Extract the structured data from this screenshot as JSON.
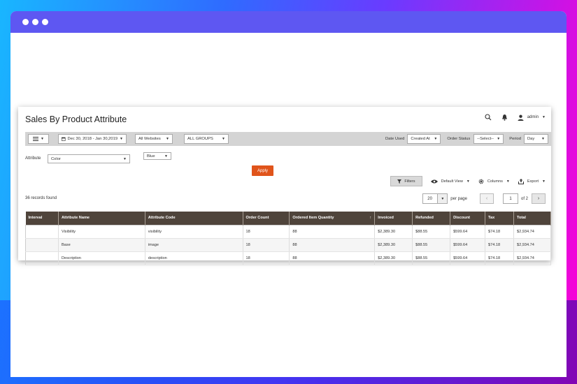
{
  "page_title": "Sales By Product Attribute",
  "header": {
    "user_name": "admin"
  },
  "toolbar": {
    "date_range": "Dec 30, 2018 - Jan 30,2019",
    "website": "All Websites",
    "group": "ALL GROUPS",
    "date_used_label": "Date Used",
    "date_used_value": "Created At",
    "order_status_label": "Order Status",
    "order_status_value": "--Select--",
    "period_label": "Period",
    "period_value": "Day"
  },
  "filter": {
    "attribute_label": "Attribute",
    "attribute_value": "Color",
    "color_value": "Blue",
    "apply_label": "Apply"
  },
  "actions": {
    "filters_label": "Filters",
    "default_view_label": "Default View",
    "columns_label": "Columns",
    "export_label": "Export"
  },
  "records_found": "36 records found",
  "pager": {
    "per_page_value": "20",
    "per_page_label": "per page",
    "current_page": "1",
    "total_pages": "of 2"
  },
  "table": {
    "columns": [
      "Interval",
      "Attribute Name",
      "Attribute Code",
      "Order Count",
      "Ordered Item Quantity",
      "Invoiced",
      "Refunded",
      "Discount",
      "Tax",
      "Total"
    ],
    "rows": [
      [
        "",
        "Visibility",
        "visibility",
        "18",
        "88",
        "$2,389.30",
        "$88.55",
        "$599.64",
        "$74.18",
        "$2,934.74"
      ],
      [
        "",
        "Base",
        "image",
        "18",
        "88",
        "$2,389.30",
        "$88.55",
        "$599.64",
        "$74.18",
        "$2,934.74"
      ],
      [
        "",
        "Description",
        "description",
        "18",
        "88",
        "$2,389.30",
        "$88.55",
        "$599.64",
        "$74.18",
        "$2,934.74"
      ]
    ]
  }
}
